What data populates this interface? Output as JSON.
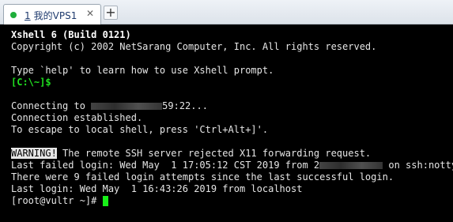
{
  "tab": {
    "index": "1",
    "title": "我的VPS1",
    "close": "✕",
    "new_tab": "+"
  },
  "colors": {
    "accent_green": "#1fae3b",
    "prompt_green": "#20e020",
    "cursor": "#18f018",
    "terminal_bg": "#000000",
    "terminal_fg": "#e6e6e6"
  },
  "terminal": {
    "banner_title": "Xshell 6 (Build 0121)",
    "copyright": "Copyright (c) 2002 NetSarang Computer, Inc. All rights reserved.",
    "help_hint": "Type `help' to learn how to use Xshell prompt.",
    "local_prompt": "[C:\\~]$",
    "connecting_prefix": "Connecting to ",
    "connecting_suffix": "59:22...",
    "established": "Connection established.",
    "escape_hint": "To escape to local shell, press 'Ctrl+Alt+]'.",
    "warning_tag": "WARNING!",
    "warning_text": " The remote SSH server rejected X11 forwarding request.",
    "last_failed_prefix": "Last failed login: Wed May  1 17:05:12 CST 2019 from 2",
    "last_failed_suffix": " on ssh:notty",
    "failed_attempts": "There were 9 failed login attempts since the last successful login.",
    "last_login": "Last login: Wed May  1 16:43:26 2019 from localhost",
    "remote_prompt": "[root@vultr ~]# "
  }
}
